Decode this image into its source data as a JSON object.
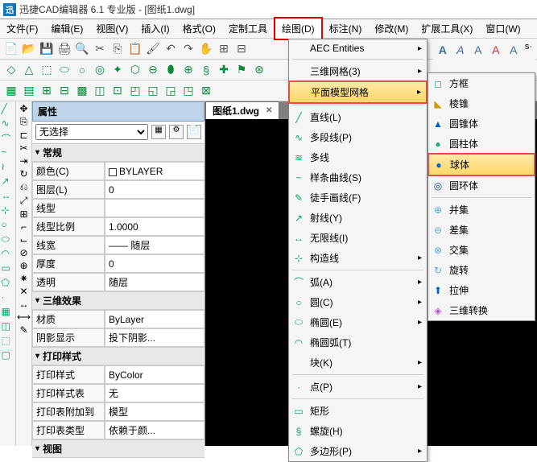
{
  "title": "迅捷CAD编辑器  6.1 专业版  -  [图纸1.dwg]",
  "menus": {
    "file": "文件(F)",
    "edit": "编辑(E)",
    "view": "视图(V)",
    "insert": "插入(I)",
    "format": "格式(O)",
    "custom": "定制工具",
    "draw": "绘图(D)",
    "annotate": "标注(N)",
    "modify": "修改(M)",
    "ext": "扩展工具(X)",
    "window": "窗口(W)"
  },
  "tab": {
    "label": "图纸1.dwg"
  },
  "prop": {
    "header": "属性",
    "selector": "无选择",
    "sections": {
      "general": "常规",
      "fx": "三维效果",
      "print": "打印样式",
      "viewtab": "视图"
    },
    "rows": {
      "color": {
        "k": "颜色(C)",
        "v": "BYLAYER"
      },
      "layer": {
        "k": "图层(L)",
        "v": "0"
      },
      "ltype": {
        "k": "线型",
        "v": ""
      },
      "ltscale": {
        "k": "线型比例",
        "v": "1.0000"
      },
      "lweight": {
        "k": "线宽",
        "v": "—— 随层"
      },
      "thick": {
        "k": "厚度",
        "v": "0"
      },
      "trans": {
        "k": "透明",
        "v": "随层"
      },
      "mat": {
        "k": "材质",
        "v": "ByLayer"
      },
      "shade": {
        "k": "阴影显示",
        "v": "投下阴影..."
      },
      "pstyle": {
        "k": "打印样式",
        "v": "ByColor"
      },
      "ptable": {
        "k": "打印样式表",
        "v": "无"
      },
      "pattach": {
        "k": "打印表附加到",
        "v": "模型"
      },
      "ptype": {
        "k": "打印表类型",
        "v": "依赖于颜..."
      }
    }
  },
  "drawMenu": [
    {
      "id": "aec",
      "label": "AEC Entities",
      "arr": true
    },
    {
      "id": "sep"
    },
    {
      "id": "mesh3d",
      "label": "三维网格(3)",
      "arr": true
    },
    {
      "id": "planemesh",
      "label": "平面模型网格",
      "arr": true,
      "hl": true
    },
    {
      "id": "sep"
    },
    {
      "id": "line",
      "label": "直线(L)",
      "ico": "╱"
    },
    {
      "id": "pline",
      "label": "多段线(P)",
      "ico": "∿"
    },
    {
      "id": "mline",
      "label": "多线",
      "ico": "≋"
    },
    {
      "id": "spline",
      "label": "样条曲线(S)",
      "ico": "~"
    },
    {
      "id": "freehand",
      "label": "徒手画线(F)",
      "ico": "✎"
    },
    {
      "id": "ray",
      "label": "射线(Y)",
      "ico": "↗"
    },
    {
      "id": "xline",
      "label": "无限线(I)",
      "ico": "↔"
    },
    {
      "id": "cline",
      "label": "构造线",
      "ico": "⊹",
      "arr": true
    },
    {
      "id": "sep"
    },
    {
      "id": "arc",
      "label": "弧(A)",
      "ico": "⌒",
      "arr": true
    },
    {
      "id": "circle",
      "label": "圆(C)",
      "ico": "○",
      "arr": true
    },
    {
      "id": "ellipse",
      "label": "椭圆(E)",
      "ico": "⬭",
      "arr": true
    },
    {
      "id": "earc",
      "label": "椭圆弧(T)",
      "ico": "◠"
    },
    {
      "id": "block",
      "label": "块(K)",
      "arr": true
    },
    {
      "id": "sep"
    },
    {
      "id": "point",
      "label": "点(P)",
      "ico": "·",
      "arr": true
    },
    {
      "id": "sep"
    },
    {
      "id": "rect",
      "label": "矩形",
      "ico": "▭"
    },
    {
      "id": "helix",
      "label": "螺旋(H)",
      "ico": "§"
    },
    {
      "id": "polygon",
      "label": "多边形(P)",
      "ico": "⬠",
      "arr": true
    }
  ],
  "subMenu": [
    {
      "id": "box",
      "label": "方框",
      "ico": "◻",
      "color": "#2a7"
    },
    {
      "id": "wedge",
      "label": "棱锥",
      "ico": "◣",
      "color": "#c90"
    },
    {
      "id": "cone",
      "label": "圆锥体",
      "ico": "▲",
      "color": "#06c"
    },
    {
      "id": "cylinder",
      "label": "圆柱体",
      "ico": "●",
      "color": "#2a7"
    },
    {
      "id": "sphere",
      "label": "球体",
      "ico": "●",
      "color": "#06c",
      "hl": true
    },
    {
      "id": "torus",
      "label": "圆环体",
      "ico": "◎",
      "color": "#049"
    },
    {
      "id": "sep"
    },
    {
      "id": "union",
      "label": "并集",
      "ico": "⊕",
      "color": "#5ad"
    },
    {
      "id": "subtract",
      "label": "差集",
      "ico": "⊖",
      "color": "#5ad"
    },
    {
      "id": "intersect",
      "label": "交集",
      "ico": "⊗",
      "color": "#5ad"
    },
    {
      "id": "rotate",
      "label": "旋转",
      "ico": "↻",
      "color": "#5ad"
    },
    {
      "id": "extrude",
      "label": "拉伸",
      "ico": "⬆",
      "color": "#06c"
    },
    {
      "id": "convert",
      "label": "三维转换",
      "ico": "◈",
      "color": "#b5c"
    }
  ],
  "topRightIcons": [
    "A",
    "A",
    "A",
    "A",
    "A"
  ]
}
